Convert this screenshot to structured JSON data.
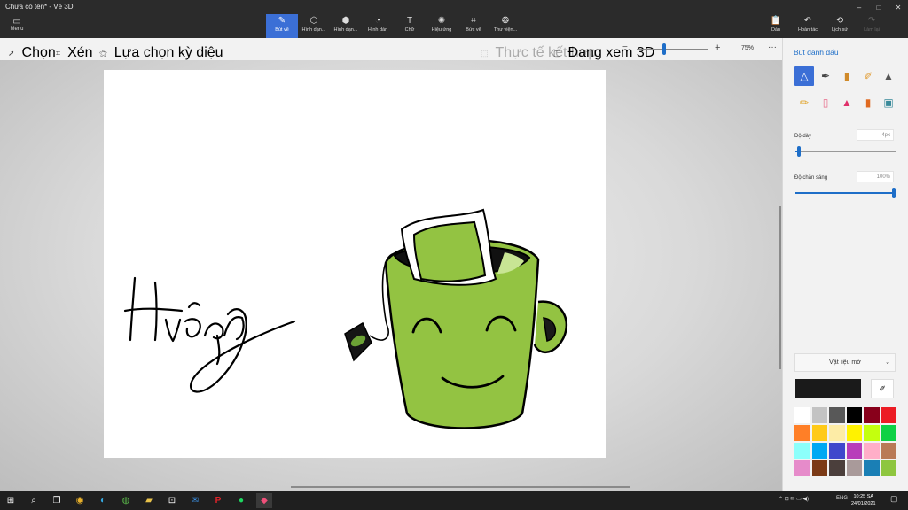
{
  "window": {
    "title": "Chưa có tên* - Vẽ 3D",
    "controls": [
      "–",
      "□",
      "✕"
    ]
  },
  "menu": {
    "label": "Menu",
    "icon": "hamburger-icon"
  },
  "toolbar": {
    "tools": [
      {
        "label": "Bút vẽ",
        "icon": "brush-icon",
        "glyph": "✎"
      },
      {
        "label": "Hình dạn...",
        "icon": "2d-shapes-icon",
        "glyph": "⬡"
      },
      {
        "label": "Hình dạn...",
        "icon": "3d-shapes-icon",
        "glyph": "⬢"
      },
      {
        "label": "Hình dán",
        "icon": "sticker-icon",
        "glyph": "◔"
      },
      {
        "label": "Chữ",
        "icon": "text-icon",
        "glyph": "T"
      },
      {
        "label": "Hiệu ứng",
        "icon": "effects-icon",
        "glyph": "✺"
      },
      {
        "label": "Bức vẽ",
        "icon": "canvas-icon",
        "glyph": "⌗"
      },
      {
        "label": "Thư viện...",
        "icon": "library-icon",
        "glyph": "❂"
      }
    ],
    "right": [
      {
        "label": "Dán",
        "icon": "paste-icon",
        "glyph": "📋"
      },
      {
        "label": "Hoàn tác",
        "icon": "undo-icon",
        "glyph": "↶"
      },
      {
        "label": "Lịch sử",
        "icon": "history-icon",
        "glyph": "⟲"
      },
      {
        "label": "Làm lại",
        "icon": "redo-icon",
        "glyph": "↷"
      }
    ]
  },
  "commands": {
    "select": "Chọn",
    "crop": "Xén",
    "magic_select": "Lựa chọn kỳ diệu",
    "mixed_reality": "Thực tế kết hợp",
    "view_3d": "Đang xem 3D",
    "zoom": "75%"
  },
  "panel": {
    "title": "Bút đánh dấu",
    "thickness_label": "Độ dày",
    "thickness_value": "4px",
    "thickness_level": 0.04,
    "opacity_label": "Độ chắn sáng",
    "opacity_value": "100%",
    "opacity_level": 1.0,
    "material": "Vật liệu mờ",
    "current_color": "#1a1a1a",
    "brushes": [
      {
        "icon": "marker-icon",
        "glyph": "△"
      },
      {
        "icon": "calligraphy-pen-icon",
        "glyph": "✒"
      },
      {
        "icon": "oil-brush-icon",
        "glyph": "▮"
      },
      {
        "icon": "watercolor-icon",
        "glyph": "✐"
      },
      {
        "icon": "pixel-pen-icon",
        "glyph": "▲"
      },
      {
        "icon": "pencil-icon",
        "glyph": "✏"
      },
      {
        "icon": "eraser-icon",
        "glyph": "▯"
      },
      {
        "icon": "crayon-icon",
        "glyph": "▲"
      },
      {
        "icon": "spray-can-icon",
        "glyph": "▮"
      },
      {
        "icon": "fill-icon",
        "glyph": "▣"
      }
    ],
    "palette": [
      "#ffffff",
      "#c3c3c3",
      "#585858",
      "#000000",
      "#88001b",
      "#ec1c24",
      "#ff7f27",
      "#ffca18",
      "#fdeca6",
      "#fff200",
      "#c4ff0e",
      "#0ed145",
      "#8cfffb",
      "#00a8f3",
      "#3f48cc",
      "#b83dba",
      "#ffaec8",
      "#b97a56",
      "#e68bca",
      "#7b3a16",
      "#4b3f3c",
      "#a99a9a",
      "#1a7fb5",
      "#8ec63f"
    ]
  },
  "taskbar": {
    "apps": [
      {
        "icon": "windows-start-icon",
        "glyph": "⊞"
      },
      {
        "icon": "search-icon",
        "glyph": "⌕"
      },
      {
        "icon": "task-view-icon",
        "glyph": "❐"
      },
      {
        "icon": "chrome-icon",
        "glyph": "◉"
      },
      {
        "icon": "edge-icon",
        "glyph": "◐"
      },
      {
        "icon": "chrome-alt-icon",
        "glyph": "◍"
      },
      {
        "icon": "file-explorer-icon",
        "glyph": "▰"
      },
      {
        "icon": "store-icon",
        "glyph": "⊡"
      },
      {
        "icon": "mail-icon",
        "glyph": "✉"
      },
      {
        "icon": "pinterest-icon",
        "glyph": "P"
      },
      {
        "icon": "spotify-icon",
        "glyph": "●"
      },
      {
        "icon": "paint3d-icon",
        "glyph": "◆"
      }
    ],
    "language": "ENG",
    "time": "10:25 SA",
    "date": "24/01/2021"
  }
}
